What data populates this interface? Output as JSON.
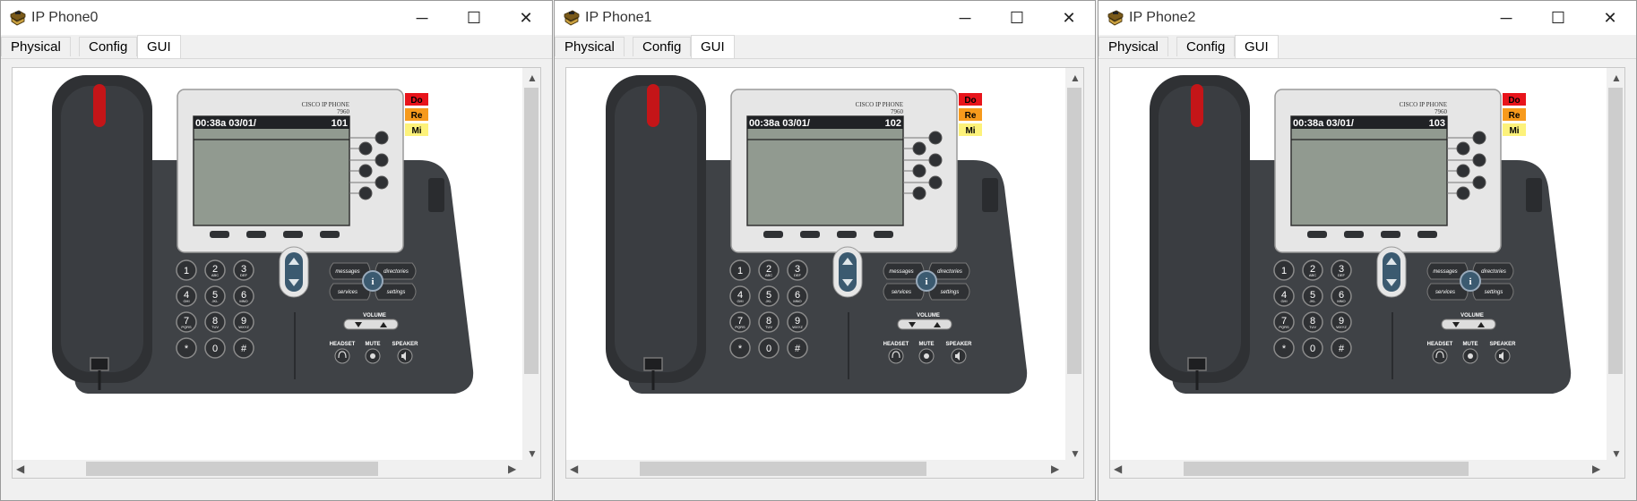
{
  "windows": [
    {
      "title": "IP Phone0",
      "tabs": [
        "Physical",
        "Config",
        "GUI"
      ],
      "active_tab": "GUI",
      "phone": {
        "brand": "CISCO IP PHONE",
        "model": "7960",
        "time": "00:38a 03/01/",
        "extension": "101"
      }
    },
    {
      "title": "IP Phone1",
      "tabs": [
        "Physical",
        "Config",
        "GUI"
      ],
      "active_tab": "GUI",
      "phone": {
        "brand": "CISCO IP PHONE",
        "model": "7960",
        "time": "00:38a 03/01/",
        "extension": "102"
      }
    },
    {
      "title": "IP Phone2",
      "tabs": [
        "Physical",
        "Config",
        "GUI"
      ],
      "active_tab": "GUI",
      "phone": {
        "brand": "CISCO IP PHONE",
        "model": "7960",
        "time": "00:38a 03/01/",
        "extension": "103"
      }
    }
  ],
  "indicators": [
    {
      "label": "Do",
      "color": "#e8141b"
    },
    {
      "label": "Re",
      "color": "#f79a1c"
    },
    {
      "label": "Mi",
      "color": "#fdf27a"
    }
  ],
  "keypad": [
    {
      "num": "1",
      "sub": ""
    },
    {
      "num": "2",
      "sub": "ABC"
    },
    {
      "num": "3",
      "sub": "DEF"
    },
    {
      "num": "4",
      "sub": "GHI"
    },
    {
      "num": "5",
      "sub": "JKL"
    },
    {
      "num": "6",
      "sub": "MNO"
    },
    {
      "num": "7",
      "sub": "PQRS"
    },
    {
      "num": "8",
      "sub": "TUV"
    },
    {
      "num": "9",
      "sub": "WXYZ"
    },
    {
      "num": "*",
      "sub": ""
    },
    {
      "num": "0",
      "sub": ""
    },
    {
      "num": "#",
      "sub": ""
    }
  ],
  "feature_buttons": {
    "messages": "messages",
    "directories": "directories",
    "services": "services",
    "settings": "settings",
    "info": "i"
  },
  "audio": {
    "volume": "VOLUME",
    "headset": "HEADSET",
    "mute": "MUTE",
    "speaker": "SPEAKER"
  },
  "window_controls": {
    "minimize": "─",
    "maximize": "☐",
    "close": "✕"
  },
  "scroll_arrows": {
    "up": "▲",
    "down": "▼",
    "left": "◀",
    "right": "▶"
  }
}
